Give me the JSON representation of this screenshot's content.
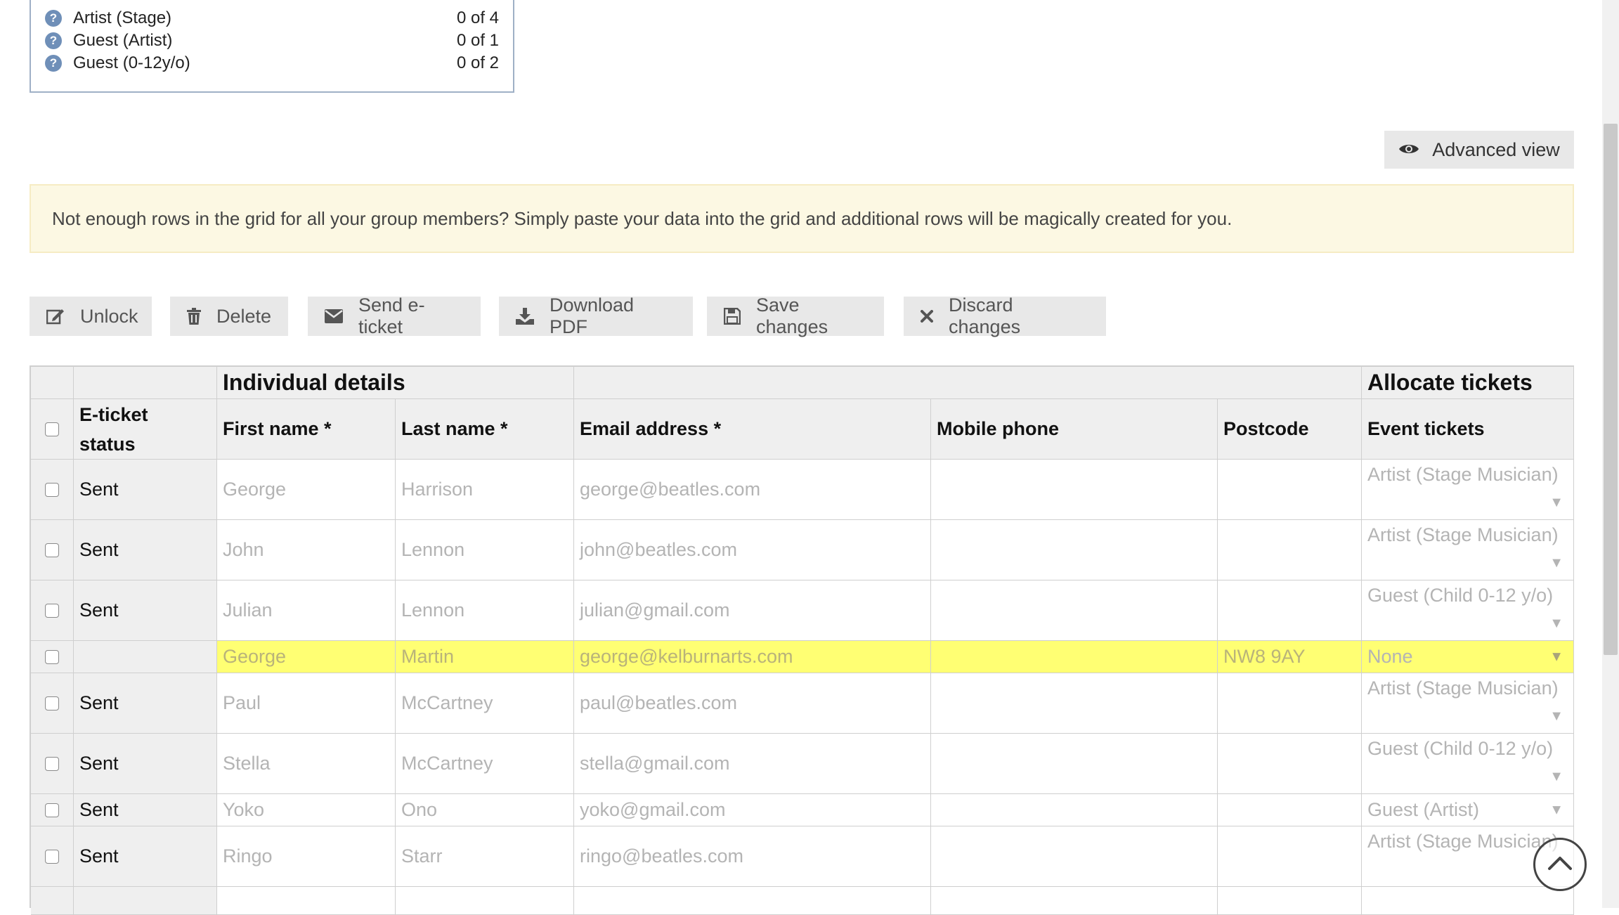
{
  "summary": {
    "rows": [
      {
        "label": "Artist (Stage)",
        "count": "0 of 4"
      },
      {
        "label": "Guest (Artist)",
        "count": "0 of 1"
      },
      {
        "label": "Guest (0-12y/o)",
        "count": "0 of 2"
      }
    ]
  },
  "advanced_view": {
    "label": "Advanced view",
    "icon": "eye-icon"
  },
  "notice": "Not enough rows in the grid for all your group members? Simply paste your data into the grid and additional rows will be magically created for you.",
  "toolbar": {
    "unlock": "Unlock",
    "delete": "Delete",
    "send": "Send e-ticket",
    "download": "Download PDF",
    "save": "Save changes",
    "discard": "Discard changes"
  },
  "grid": {
    "group_headers": {
      "individual": "Individual details",
      "allocate": "Allocate tickets"
    },
    "columns": {
      "status_line1": "E-ticket",
      "status_line2": "status",
      "first": "First name *",
      "last": "Last name *",
      "email": "Email address *",
      "mobile": "Mobile phone",
      "postcode": "Postcode",
      "tickets": "Event tickets"
    },
    "rows": [
      {
        "status": "Sent",
        "first": "George",
        "last": "Harrison",
        "email": "george@beatles.com",
        "mobile": "",
        "postcode": "",
        "ticket": "Artist (Stage Musician)"
      },
      {
        "status": "Sent",
        "first": "John",
        "last": "Lennon",
        "email": "john@beatles.com",
        "mobile": "",
        "postcode": "",
        "ticket": "Artist (Stage Musician)"
      },
      {
        "status": "Sent",
        "first": "Julian",
        "last": "Lennon",
        "email": "julian@gmail.com",
        "mobile": "",
        "postcode": "",
        "ticket": "Guest (Child 0-12 y/o)"
      },
      {
        "status": "",
        "first": "George",
        "last": "Martin",
        "email": "george@kelburnarts.com",
        "mobile": "",
        "postcode": "NW8 9AY",
        "ticket": "None"
      },
      {
        "status": "Sent",
        "first": "Paul",
        "last": "McCartney",
        "email": "paul@beatles.com",
        "mobile": "",
        "postcode": "",
        "ticket": "Artist (Stage Musician)"
      },
      {
        "status": "Sent",
        "first": "Stella",
        "last": "McCartney",
        "email": "stella@gmail.com",
        "mobile": "",
        "postcode": "",
        "ticket": "Guest (Child 0-12 y/o)"
      },
      {
        "status": "Sent",
        "first": "Yoko",
        "last": "Ono",
        "email": "yoko@gmail.com",
        "mobile": "",
        "postcode": "",
        "ticket": "Guest (Artist)"
      },
      {
        "status": "Sent",
        "first": "Ringo",
        "last": "Starr",
        "email": "ringo@beatles.com",
        "mobile": "",
        "postcode": "",
        "ticket": "Artist (Stage Musician)"
      }
    ]
  },
  "colors": {
    "highlight_row": "#ffff73",
    "notice_bg": "#fcf8e3",
    "header_bg": "#efefef"
  }
}
